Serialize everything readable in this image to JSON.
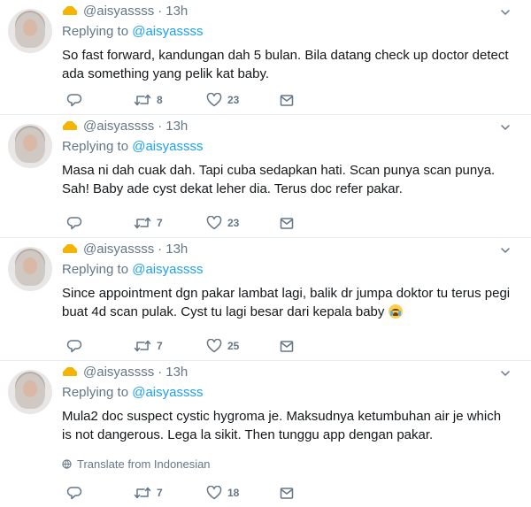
{
  "tweets": [
    {
      "handle": "@aisyassss",
      "separator": "·",
      "time": "13h",
      "replying_label": "Replying to",
      "replying_to": "@aisyassss",
      "text": "So fast forward,  kandungan dah 5 bulan. Bila datang check up doctor detect ada something yang pelik kat baby.",
      "retweets": "8",
      "likes": "23"
    },
    {
      "handle": "@aisyassss",
      "separator": "·",
      "time": "13h",
      "replying_label": "Replying to",
      "replying_to": "@aisyassss",
      "text": "Masa ni dah cuak dah. Tapi cuba sedapkan hati. Scan punya scan punya. Sah! Baby ade cyst dekat leher dia. Terus doc refer pakar.",
      "retweets": "7",
      "likes": "23"
    },
    {
      "handle": "@aisyassss",
      "separator": "·",
      "time": "13h",
      "replying_label": "Replying to",
      "replying_to": "@aisyassss",
      "text": "Since appointment dgn pakar lambat lagi,  balik dr jumpa doktor tu terus pegi buat 4d scan pulak. Cyst tu lagi besar dari kepala baby",
      "emoji": "loudly-crying-face",
      "retweets": "7",
      "likes": "25"
    },
    {
      "handle": "@aisyassss",
      "separator": "·",
      "time": "13h",
      "replying_label": "Replying to",
      "replying_to": "@aisyassss",
      "text": "Mula2 doc suspect cystic hygroma je. Maksudnya ketumbuhan air je which is not dangerous. Lega la sikit. Then tunggu app dengan pakar.",
      "translate": "Translate from Indonesian",
      "retweets": "7",
      "likes": "18"
    }
  ],
  "icons": {
    "badge": "crown-icon",
    "menu": "chevron-down-icon",
    "reply": "reply-icon",
    "retweet": "retweet-icon",
    "like": "heart-icon",
    "dm": "envelope-icon",
    "translate": "globe-icon"
  },
  "colors": {
    "link": "#1da1f2",
    "muted": "#657786",
    "text": "#14171a",
    "divider": "#e6ecf0",
    "crown": "#f5b400"
  }
}
